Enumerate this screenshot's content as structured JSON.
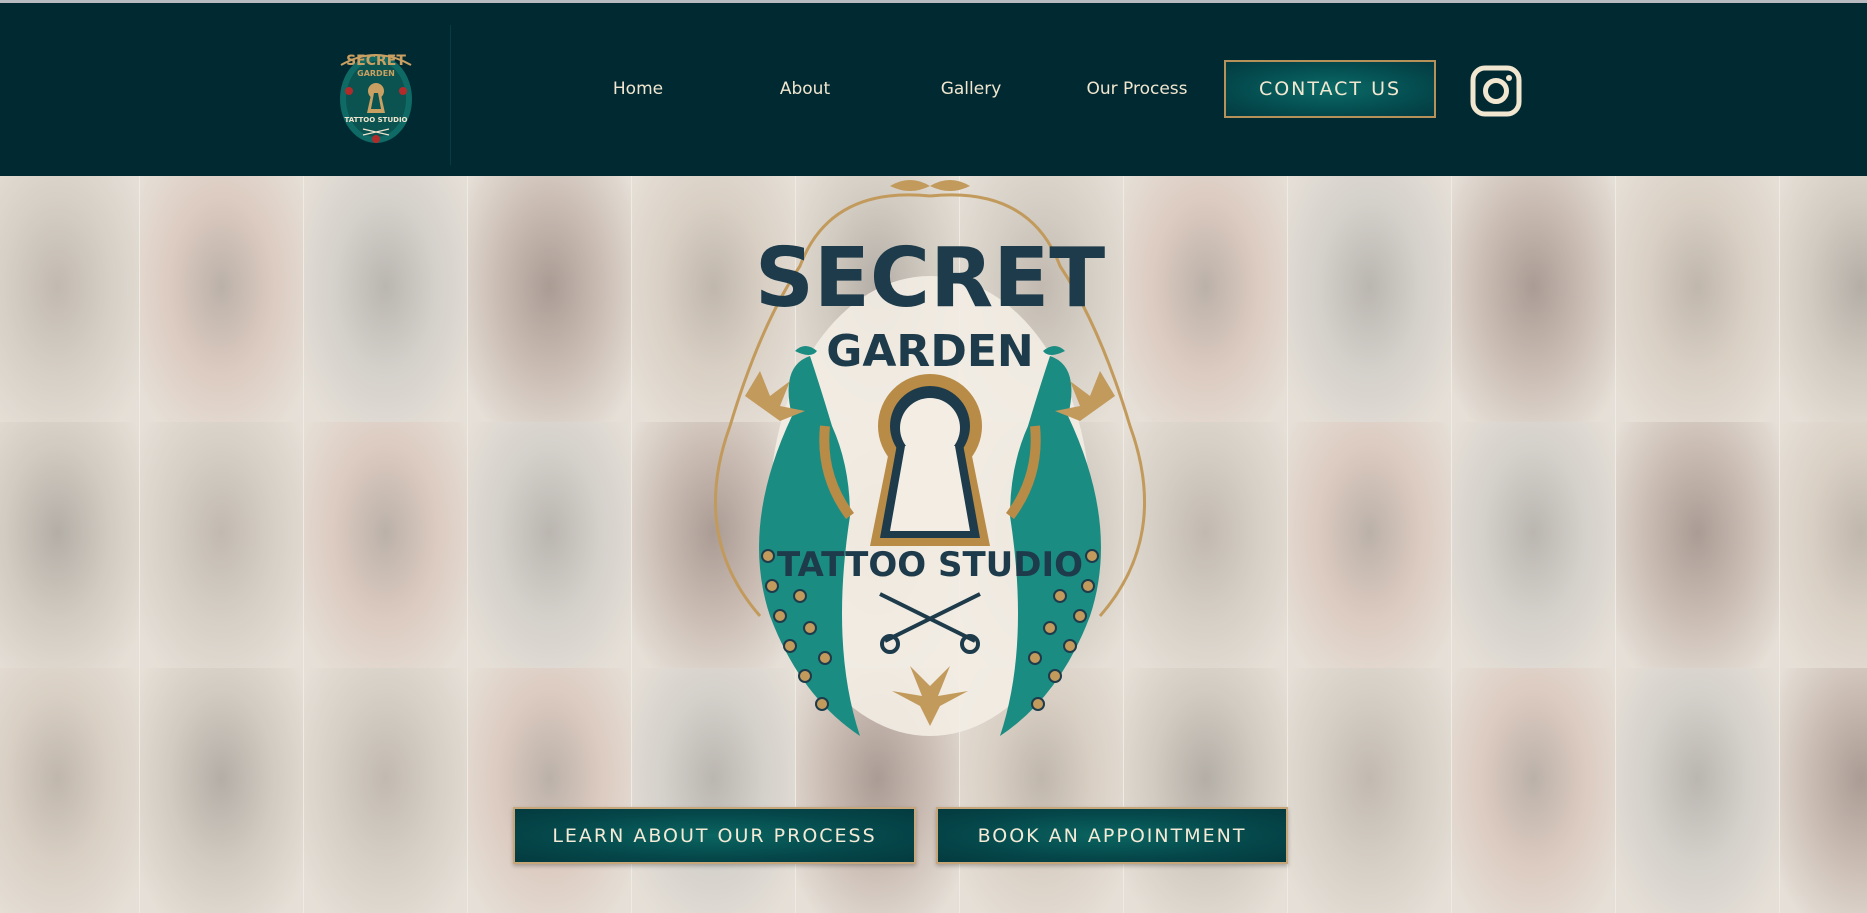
{
  "brand": {
    "name_line1": "SECRET",
    "name_line2": "GARDEN",
    "name_line3": "TATTOO STUDIO"
  },
  "nav": {
    "items": [
      {
        "label": "Home"
      },
      {
        "label": "About"
      },
      {
        "label": "Gallery"
      },
      {
        "label": "Our Process"
      }
    ],
    "contact_label": "CONTACT US",
    "instagram_icon": "instagram-icon"
  },
  "hero": {
    "buttons": {
      "process_label": "LEARN ABOUT OUR PROCESS",
      "appointment_label": "BOOK AN APPOINTMENT"
    }
  },
  "colors": {
    "header_bg": "#012932",
    "accent_gold": "#b6925a",
    "teal": "#1c8a80",
    "navy": "#1c3a4a",
    "cream": "#f1e6cf"
  }
}
